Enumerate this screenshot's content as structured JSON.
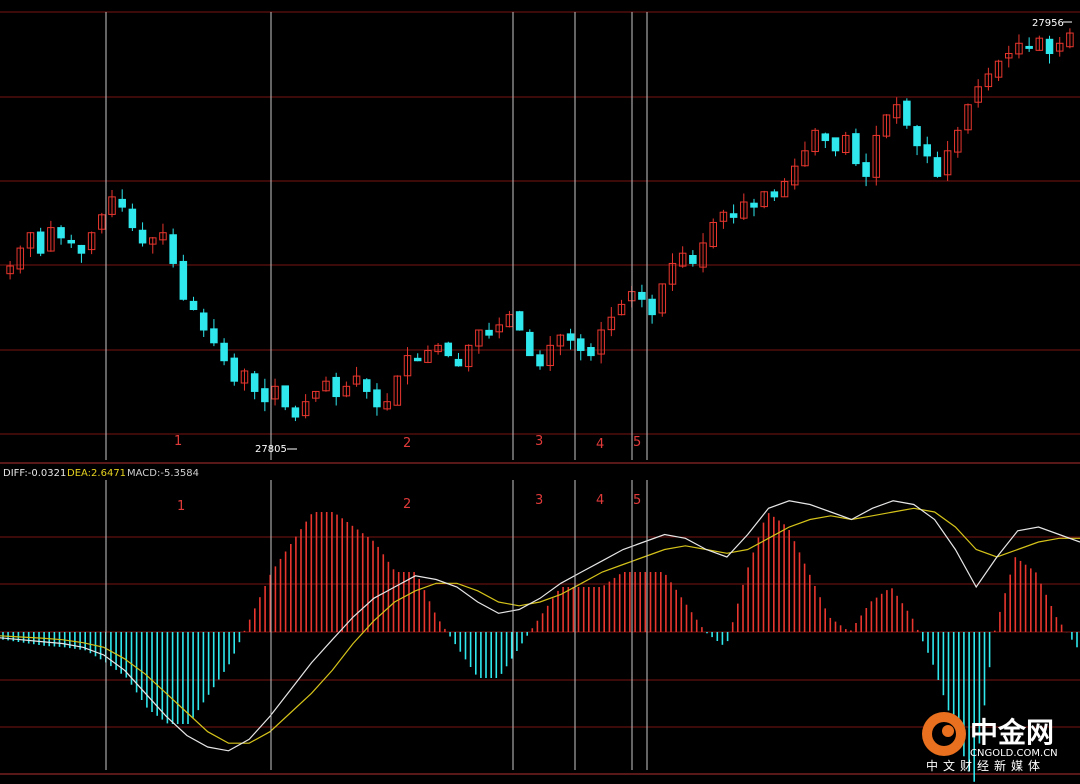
{
  "price_panel": {
    "high_label": "27956",
    "low_label": "27805"
  },
  "indicator_legend": {
    "diff": "DIFF:-0.0321",
    "dea": "DEA:2.6471",
    "macd": "MACD:-5.3584"
  },
  "markers": [
    "1",
    "2",
    "3",
    "4",
    "5"
  ],
  "logo": {
    "name_cn": "中金网",
    "domain": "CNGOLD.COM.CN",
    "subtitle": "中文财经新媒体"
  },
  "colors": {
    "background": "#000000",
    "grid": "#7a1414",
    "up_candle": "#e8362e",
    "down_candle": "#2ee8ee",
    "diff_line": "#e6e6e6",
    "dea_line": "#d4c21a",
    "marker_text": "#e03a3a",
    "marker_line": "#c8c8c8"
  },
  "chart_data": [
    {
      "type": "candlestick",
      "title": "",
      "ylim": [
        27790,
        27965
      ],
      "labeled_high": 27956,
      "labeled_low": 27805,
      "close_path": [
        27865,
        27872,
        27878,
        27870,
        27880,
        27876,
        27874,
        27870,
        27878,
        27885,
        27892,
        27888,
        27880,
        27874,
        27876,
        27878,
        27866,
        27852,
        27848,
        27840,
        27835,
        27828,
        27820,
        27824,
        27816,
        27812,
        27818,
        27810,
        27806,
        27812,
        27816,
        27820,
        27814,
        27818,
        27822,
        27816,
        27810,
        27812,
        27822,
        27830,
        27828,
        27832,
        27834,
        27830,
        27826,
        27834,
        27840,
        27838,
        27842,
        27846,
        27840,
        27830,
        27826,
        27834,
        27838,
        27836,
        27832,
        27830,
        27840,
        27845,
        27850,
        27855,
        27852,
        27846,
        27858,
        27866,
        27870,
        27866,
        27874,
        27882,
        27886,
        27884,
        27890,
        27888,
        27894,
        27892,
        27898,
        27904,
        27910,
        27918,
        27914,
        27910,
        27916,
        27905,
        27900,
        27916,
        27924,
        27928,
        27920,
        27912,
        27908,
        27900,
        27910,
        27918,
        27928,
        27935,
        27940,
        27945,
        27948,
        27952,
        27950,
        27954,
        27948,
        27952,
        27956
      ],
      "markers": [
        "1",
        "2",
        "3",
        "4",
        "5"
      ]
    },
    {
      "type": "line",
      "title": "",
      "series": [
        {
          "name": "DIFF",
          "values": [
            -1.5,
            -2,
            -2.5,
            -3,
            -4,
            -6,
            -10,
            -16,
            -22,
            -27,
            -30,
            -31,
            -28,
            -22,
            -15,
            -8,
            -2,
            4,
            9,
            12,
            15,
            14,
            12,
            8,
            5,
            6,
            9,
            13,
            16,
            19,
            22,
            24,
            26,
            25,
            22,
            20,
            26,
            33,
            35,
            34,
            32,
            30,
            33,
            35,
            34,
            30,
            22,
            12,
            20,
            27,
            28,
            26,
            24
          ]
        },
        {
          "name": "DEA",
          "values": [
            -1,
            -1.3,
            -1.6,
            -2,
            -2.8,
            -4,
            -7,
            -11,
            -16,
            -21,
            -26,
            -29,
            -29,
            -26,
            -21,
            -16,
            -10,
            -3,
            3,
            8,
            11,
            13,
            13,
            11,
            8,
            7,
            8,
            10,
            13,
            16,
            18,
            20,
            22,
            23,
            22,
            21,
            22,
            25,
            28,
            30,
            31,
            30,
            31,
            32,
            33,
            32,
            28,
            22,
            20,
            22,
            24,
            25,
            25
          ]
        },
        {
          "name": "MACD",
          "values": [
            -0.5,
            -0.7,
            -0.9,
            -1,
            -1.2,
            -2,
            -3,
            -5,
            -6,
            -6,
            -4,
            -2,
            1,
            4,
            6,
            8,
            8,
            7,
            6,
            4,
            4,
            1,
            -1,
            -3,
            -3,
            -1,
            1,
            3,
            3,
            3,
            4,
            4,
            4,
            2,
            0,
            -1,
            4,
            8,
            7,
            4,
            1,
            0,
            2,
            3,
            1,
            -2,
            -6,
            -10,
            0,
            5,
            4,
            1,
            -1
          ]
        }
      ],
      "legend": [
        "DIFF:-0.0321",
        "DEA:2.6471",
        "MACD:-5.3584"
      ],
      "markers": [
        "1",
        "2",
        "3",
        "4",
        "5"
      ]
    }
  ]
}
